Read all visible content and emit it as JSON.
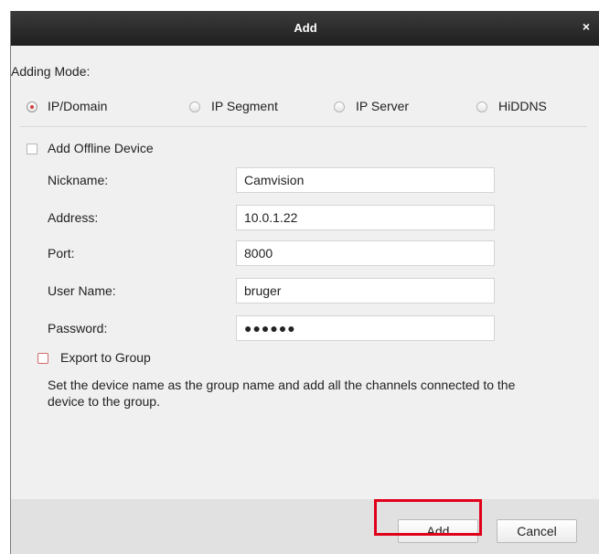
{
  "window": {
    "title": "Add",
    "close_icon": "close-icon"
  },
  "adding_mode": {
    "label": "Adding Mode:",
    "options": [
      {
        "label": "IP/Domain",
        "selected": true
      },
      {
        "label": "IP Segment",
        "selected": false
      },
      {
        "label": "IP Server",
        "selected": false
      },
      {
        "label": "HiDDNS",
        "selected": false
      }
    ]
  },
  "offline": {
    "label": "Add Offline Device",
    "checked": false
  },
  "form": {
    "nickname": {
      "label": "Nickname:",
      "value": "Camvision"
    },
    "address": {
      "label": "Address:",
      "value": "10.0.1.22"
    },
    "port": {
      "label": "Port:",
      "value": "8000"
    },
    "username": {
      "label": "User Name:",
      "value": "bruger"
    },
    "password": {
      "label": "Password:",
      "value": "●●●●●●"
    }
  },
  "export_group": {
    "label": "Export to Group",
    "checked": false,
    "description": "Set the device name as the group name and add all the channels connected to the device to the group."
  },
  "buttons": {
    "add": "Add",
    "cancel": "Cancel"
  },
  "colors": {
    "titlebar": "#2b2b2b",
    "radio_selected": "#d93b3b",
    "highlight": "#e0001a"
  }
}
